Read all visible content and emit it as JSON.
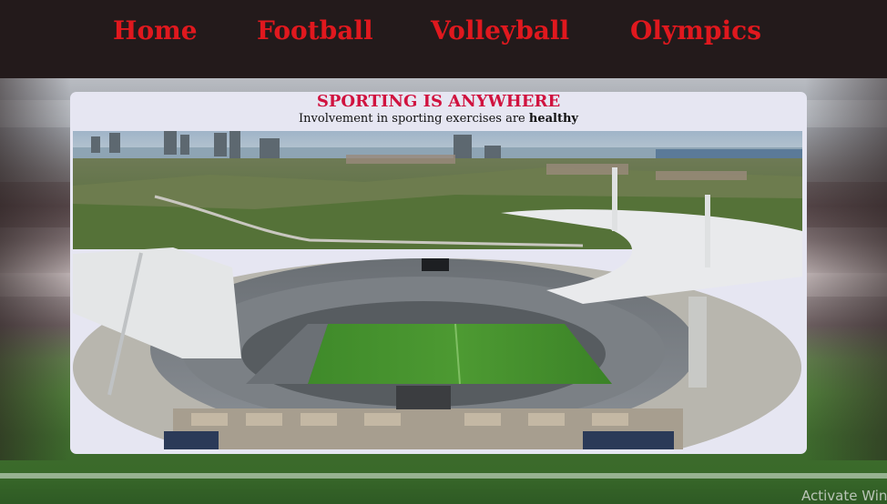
{
  "nav": {
    "items": [
      {
        "label": "Home"
      },
      {
        "label": "Football"
      },
      {
        "label": "Volleyball"
      },
      {
        "label": "Olympics"
      }
    ]
  },
  "card": {
    "title": "SPORTING IS ANYWHERE",
    "subtitle_prefix": "Involvement in sporting exercises are ",
    "subtitle_bold": "healthy"
  },
  "watermark": "Activate Windows",
  "colors": {
    "nav_bg": "#231a1b",
    "nav_link": "#e0181e",
    "title": "#d0123f",
    "card_bg": "#e6e6f2"
  }
}
